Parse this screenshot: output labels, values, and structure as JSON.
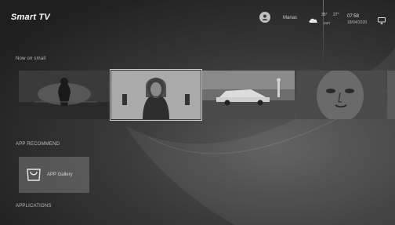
{
  "header": {
    "title": "Smart TV",
    "account": {
      "label": "Manas",
      "icon": "account-icon"
    },
    "weather": {
      "icon": "weather-cloud-icon",
      "high": "35°",
      "low": "27°",
      "condition": "sun"
    },
    "clock": {
      "time": "07:58",
      "date": "18/04/2020"
    },
    "input_icon": "input-source-icon"
  },
  "sections": {
    "now": {
      "label": "Now on small"
    },
    "recommended": {
      "label": "APP RECOMMEND"
    },
    "applications": {
      "label": "APPLICATIONS"
    }
  },
  "now_row": {
    "tiles": [
      {
        "name": "media-tile-1"
      },
      {
        "name": "media-tile-2",
        "focused": true
      },
      {
        "name": "media-tile-3"
      },
      {
        "name": "media-tile-4"
      },
      {
        "name": "media-tile-5"
      }
    ]
  },
  "recommend_row": {
    "tiles": [
      {
        "label": "APP Gallery",
        "icon": "shopping-bag-icon"
      }
    ]
  }
}
